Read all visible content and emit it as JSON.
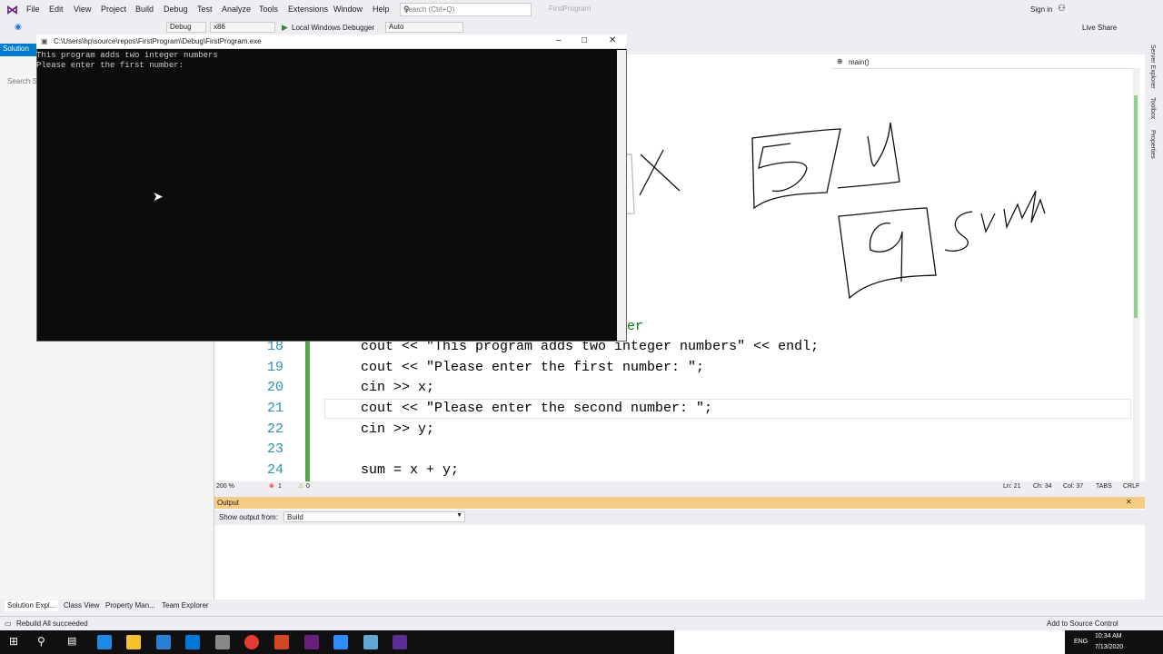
{
  "menu": {
    "items": [
      "File",
      "Edit",
      "View",
      "Project",
      "Build",
      "Debug",
      "Test",
      "Analyze",
      "Tools",
      "Extensions",
      "Window",
      "Help"
    ],
    "search_placeholder": "Search (Ctrl+Q)",
    "project_name": "FirstProgram",
    "sign_in": "Sign in",
    "live_share": "Live Share"
  },
  "toolbar": {
    "config": "Debug",
    "platform": "x86",
    "debugger": "Local Windows Debugger",
    "auto": "Auto"
  },
  "solution": {
    "header": "Solution",
    "search": "Search S"
  },
  "console": {
    "title": "C:\\Users\\hp\\source\\repos\\FirstProgram\\Debug\\FirstProgram.exe",
    "lines": [
      "This program adds two integer numbers",
      "Please enter the first number:"
    ]
  },
  "editor": {
    "nav_scope": "main()",
    "partial_comment": "er",
    "lines": [
      {
        "num": "18",
        "code": "cout << \"This program adds two integer numbers\" << endl;"
      },
      {
        "num": "19",
        "code": "cout << \"Please enter the first number: \";"
      },
      {
        "num": "20",
        "code": "cin >> x;"
      },
      {
        "num": "21",
        "code": "cout << \"Please enter the second number: \";"
      },
      {
        "num": "22",
        "code": "cin >> y;"
      },
      {
        "num": "23",
        "code": ""
      },
      {
        "num": "24",
        "code": "sum = x + y;"
      }
    ],
    "zoom": "200 %",
    "errors": "1",
    "warnings": "0",
    "ln": "Ln: 21",
    "ch": "Ch: 34",
    "col": "Col: 37",
    "tabs": "TABS",
    "crlf": "CRLF"
  },
  "output": {
    "title": "Output",
    "show_from_label": "Show output from:",
    "source": "Build"
  },
  "bottom_tabs": [
    "Solution Expl...",
    "Class View",
    "Property Man...",
    "Team Explorer"
  ],
  "status": {
    "message": "Rebuild All succeeded",
    "source_control": "Add to Source Control"
  },
  "right_tabs": [
    "Server Explorer",
    "Toolbox",
    "Properties"
  ],
  "tray": {
    "lang": "ENG",
    "time": "10:34 AM",
    "date": "7/13/2020"
  }
}
